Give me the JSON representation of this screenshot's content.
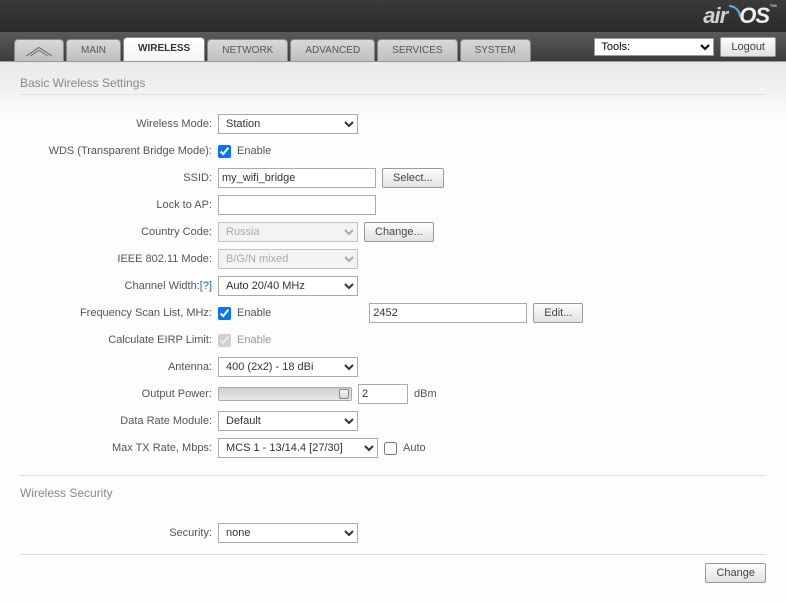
{
  "brand": {
    "air": "air",
    "os": "OS"
  },
  "tabs": {
    "main": "MAIN",
    "wireless": "WIRELESS",
    "network": "NETWORK",
    "advanced": "ADVANCED",
    "services": "SERVICES",
    "system": "SYSTEM"
  },
  "tools": {
    "label": "Tools:"
  },
  "logout": "Logout",
  "sections": {
    "basic": "Basic Wireless Settings",
    "security": "Wireless Security"
  },
  "labels": {
    "wireless_mode": "Wireless Mode:",
    "wds": "WDS (Transparent Bridge Mode):",
    "ssid": "SSID:",
    "lock_ap": "Lock to AP:",
    "country": "Country Code:",
    "ieee": "IEEE 802.11 Mode:",
    "chanwidth": "Channel Width:",
    "help": "[?]",
    "freqscan": "Frequency Scan List, MHz:",
    "eirp": "Calculate EIRP Limit:",
    "antenna": "Antenna:",
    "output_power": "Output Power:",
    "data_rate": "Data Rate Module:",
    "max_tx": "Max TX Rate, Mbps:",
    "security": "Security:",
    "enable": "Enable",
    "auto": "Auto",
    "dbm": "dBm"
  },
  "values": {
    "wireless_mode": "Station",
    "wds_enable": true,
    "ssid": "my_wifi_bridge",
    "lock_ap": "",
    "country": "Russia",
    "ieee": "B/G/N mixed",
    "chanwidth": "Auto 20/40 MHz",
    "freqscan_enable": true,
    "freqscan_value": "2452",
    "eirp_enable": true,
    "antenna": "400 (2x2) - 18 dBi",
    "output_power": "2",
    "data_rate": "Default",
    "max_tx": "MCS 1 - 13/14.4 [27/30]",
    "max_tx_auto": false,
    "security": "none"
  },
  "buttons": {
    "select": "Select...",
    "change": "Change...",
    "edit": "Edit...",
    "change_footer": "Change"
  }
}
